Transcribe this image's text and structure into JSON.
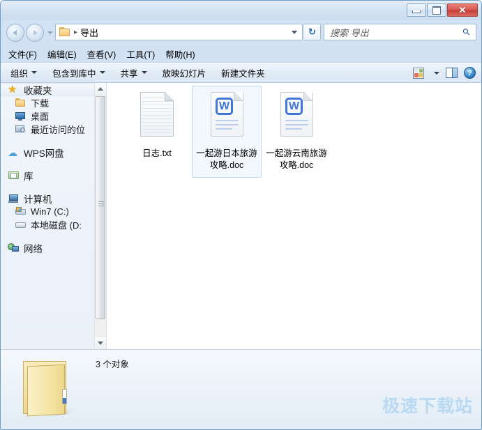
{
  "window": {
    "controls": {
      "minimize": "−",
      "maximize": "□",
      "close": "✕"
    }
  },
  "addressbar": {
    "folder_icon": "folder-icon",
    "separator": "▸",
    "path": "导出",
    "dropdown_icon": "chevron-down-icon",
    "refresh_icon": "↻",
    "back_icon": "back-arrow-icon",
    "forward_icon": "forward-arrow-icon",
    "history_icon": "history-dropdown-icon"
  },
  "search": {
    "placeholder": "搜索 导出",
    "icon": "search-icon"
  },
  "menubar": {
    "items": [
      {
        "label": "文件(F)"
      },
      {
        "label": "编辑(E)"
      },
      {
        "label": "查看(V)"
      },
      {
        "label": "工具(T)"
      },
      {
        "label": "帮助(H)"
      }
    ]
  },
  "commandbar": {
    "items": [
      {
        "label": "组织",
        "has_caret": true
      },
      {
        "label": "包含到库中",
        "has_caret": true
      },
      {
        "label": "共享",
        "has_caret": true
      },
      {
        "label": "放映幻灯片",
        "has_caret": false
      },
      {
        "label": "新建文件夹",
        "has_caret": false
      }
    ],
    "view_icon": "view-options-icon",
    "view_caret": "chevron-down-icon",
    "preview_icon": "preview-pane-icon",
    "help_icon": "help-icon",
    "help_glyph": "?"
  },
  "sidebar": {
    "groups": [
      {
        "root": {
          "label": "收藏夹",
          "icon": "star-icon"
        },
        "children": [
          {
            "label": "下载",
            "icon": "folder-icon"
          },
          {
            "label": "桌面",
            "icon": "desktop-icon"
          },
          {
            "label": "最近访问的位",
            "icon": "recent-places-icon"
          }
        ]
      },
      {
        "root": {
          "label": "WPS网盘",
          "icon": "cloud-icon"
        },
        "children": []
      },
      {
        "root": {
          "label": "库",
          "icon": "library-icon"
        },
        "children": []
      },
      {
        "root": {
          "label": "计算机",
          "icon": "computer-icon"
        },
        "children": [
          {
            "label": "Win7 (C:)",
            "icon": "windows-drive-icon"
          },
          {
            "label": "本地磁盘 (D:",
            "icon": "drive-icon"
          }
        ]
      },
      {
        "root": {
          "label": "网络",
          "icon": "network-icon"
        },
        "children": []
      }
    ],
    "scrollbar": {
      "up_icon": "scroll-up-arrow-icon",
      "down_icon": "scroll-down-arrow-icon"
    }
  },
  "files": [
    {
      "name": "日志.txt",
      "type": "txt",
      "selected": false
    },
    {
      "name": "一起游日本旅游攻略.doc",
      "type": "doc",
      "doc_glyph": "W",
      "selected": true
    },
    {
      "name": "一起游云南旅游攻略.doc",
      "type": "doc",
      "doc_glyph": "W",
      "selected": false
    }
  ],
  "statusbar": {
    "folder_icon": "open-folder-icon",
    "count_text": "3 个对象",
    "watermark": "极速下载站"
  }
}
